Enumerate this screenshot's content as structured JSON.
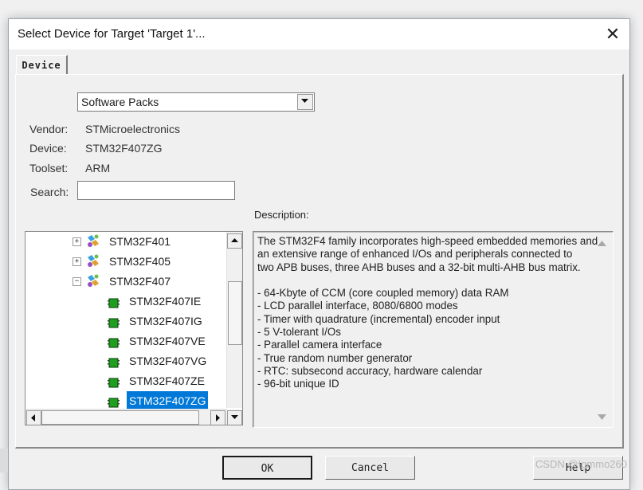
{
  "window": {
    "title": "Select Device for Target 'Target 1'...",
    "close_glyph": "✕"
  },
  "tabs": [
    {
      "label": "Device"
    }
  ],
  "packs_combo": {
    "selected": "Software Packs"
  },
  "info": {
    "vendor_label": "Vendor:",
    "vendor_value": "STMicroelectronics",
    "device_label": "Device:",
    "device_value": "STM32F407ZG",
    "toolset_label": "Toolset:",
    "toolset_value": "ARM",
    "search_label": "Search:",
    "search_value": ""
  },
  "tree": {
    "families": [
      {
        "label": "STM32F401",
        "expander": "+"
      },
      {
        "label": "STM32F405",
        "expander": "+"
      },
      {
        "label": "STM32F407",
        "expander": "−"
      }
    ],
    "devices": [
      {
        "label": "STM32F407IE"
      },
      {
        "label": "STM32F407IG"
      },
      {
        "label": "STM32F407VE"
      },
      {
        "label": "STM32F407VG"
      },
      {
        "label": "STM32F407ZE"
      },
      {
        "label": "STM32F407ZG"
      }
    ]
  },
  "description": {
    "label": "Description:",
    "lines": [
      "The STM32F4 family incorporates high-speed embedded memories and",
      "an extensive range of enhanced I/Os and peripherals connected to",
      "two APB buses, three AHB buses and a 32-bit multi-AHB bus matrix.",
      "",
      " - 64-Kbyte of CCM (core coupled memory) data RAM",
      " - LCD parallel interface, 8080/6800 modes",
      " - Timer with quadrature (incremental) encoder input",
      " - 5 V-tolerant I/Os",
      " - Parallel camera interface",
      " - True random number generator",
      " - RTC: subsecond accuracy, hardware calendar",
      " - 96-bit unique ID"
    ]
  },
  "buttons": {
    "ok": "OK",
    "cancel": "Cancel",
    "help": "Help"
  },
  "watermark": "CSDN @Igmmo260",
  "colors": {
    "selection": "#0078d7",
    "chip_green": "#1ea01e"
  }
}
